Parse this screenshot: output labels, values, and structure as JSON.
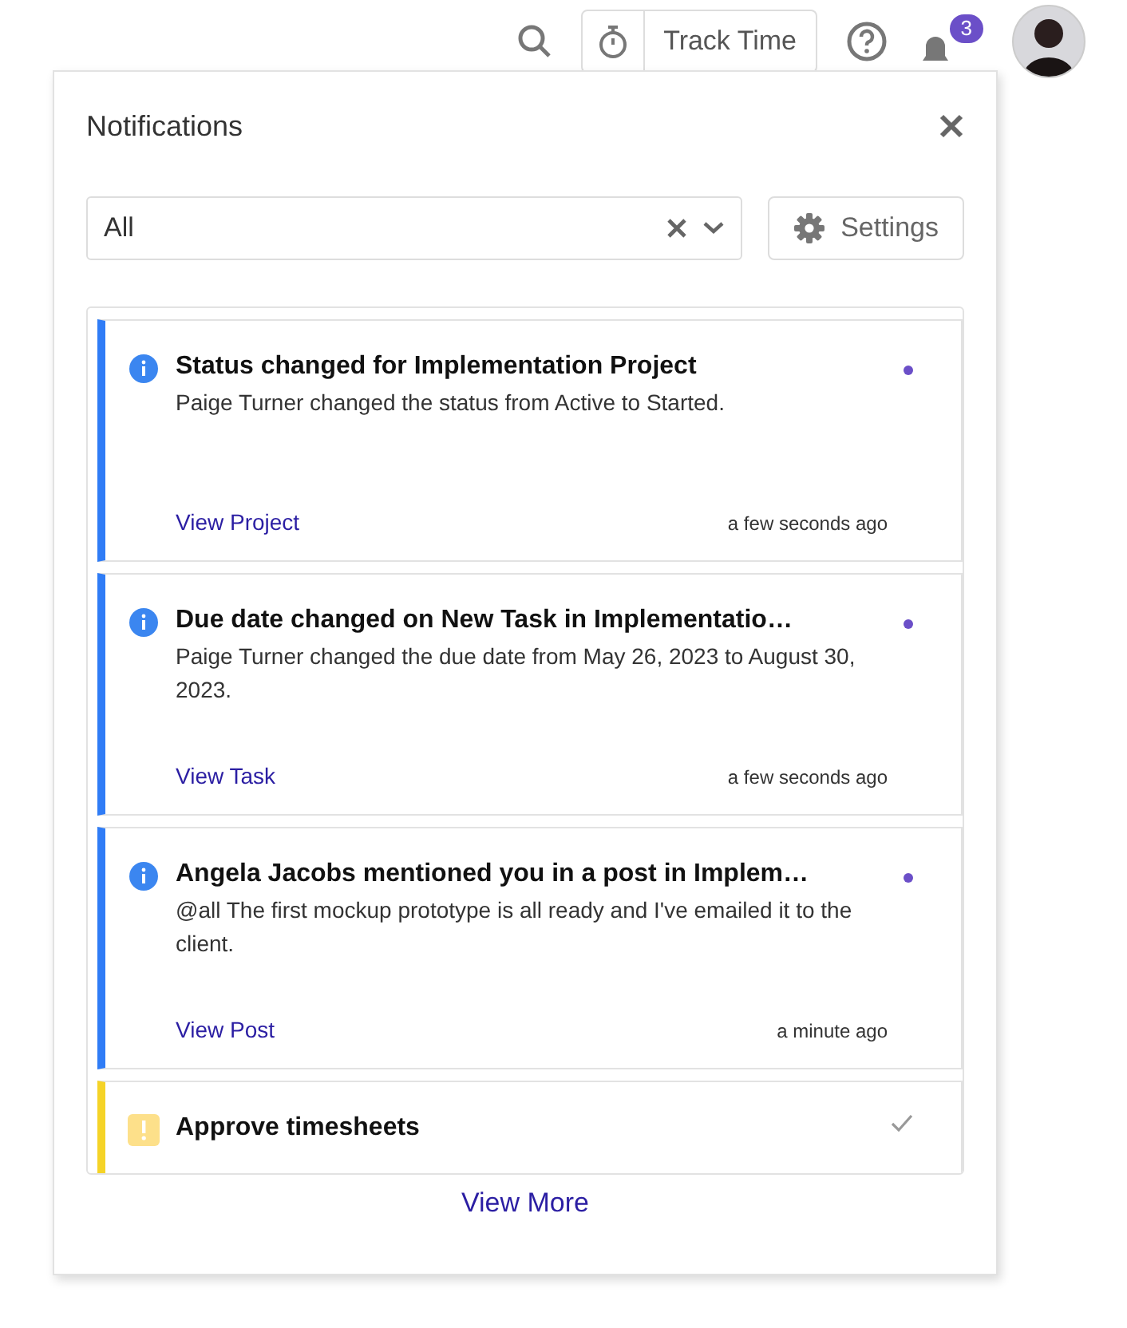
{
  "topbar": {
    "track_time": "Track Time",
    "badge": "3"
  },
  "panel": {
    "title": "Notifications",
    "filter": {
      "value": "All"
    },
    "settings": "Settings",
    "notifications": [
      {
        "kind": "info",
        "read": false,
        "title": "Status changed for Implementation Project",
        "body": "Paige Turner changed the status from Active to Started.",
        "link": "View Project",
        "time": "a few seconds ago"
      },
      {
        "kind": "info",
        "read": false,
        "title": "Due date changed on New Task in Implementatio…",
        "body": "Paige Turner changed the due date from May 26, 2023 to August 30, 2023.",
        "link": "View Task",
        "time": "a few seconds ago"
      },
      {
        "kind": "info",
        "read": false,
        "title": "Angela Jacobs mentioned you in a post in Implem…",
        "body": "@all The first mockup prototype is all ready and I've emailed it to the client.",
        "link": "View Post",
        "time": "a minute ago"
      },
      {
        "kind": "warning",
        "read": true,
        "title": "Approve timesheets"
      }
    ],
    "view_more": "View More"
  }
}
